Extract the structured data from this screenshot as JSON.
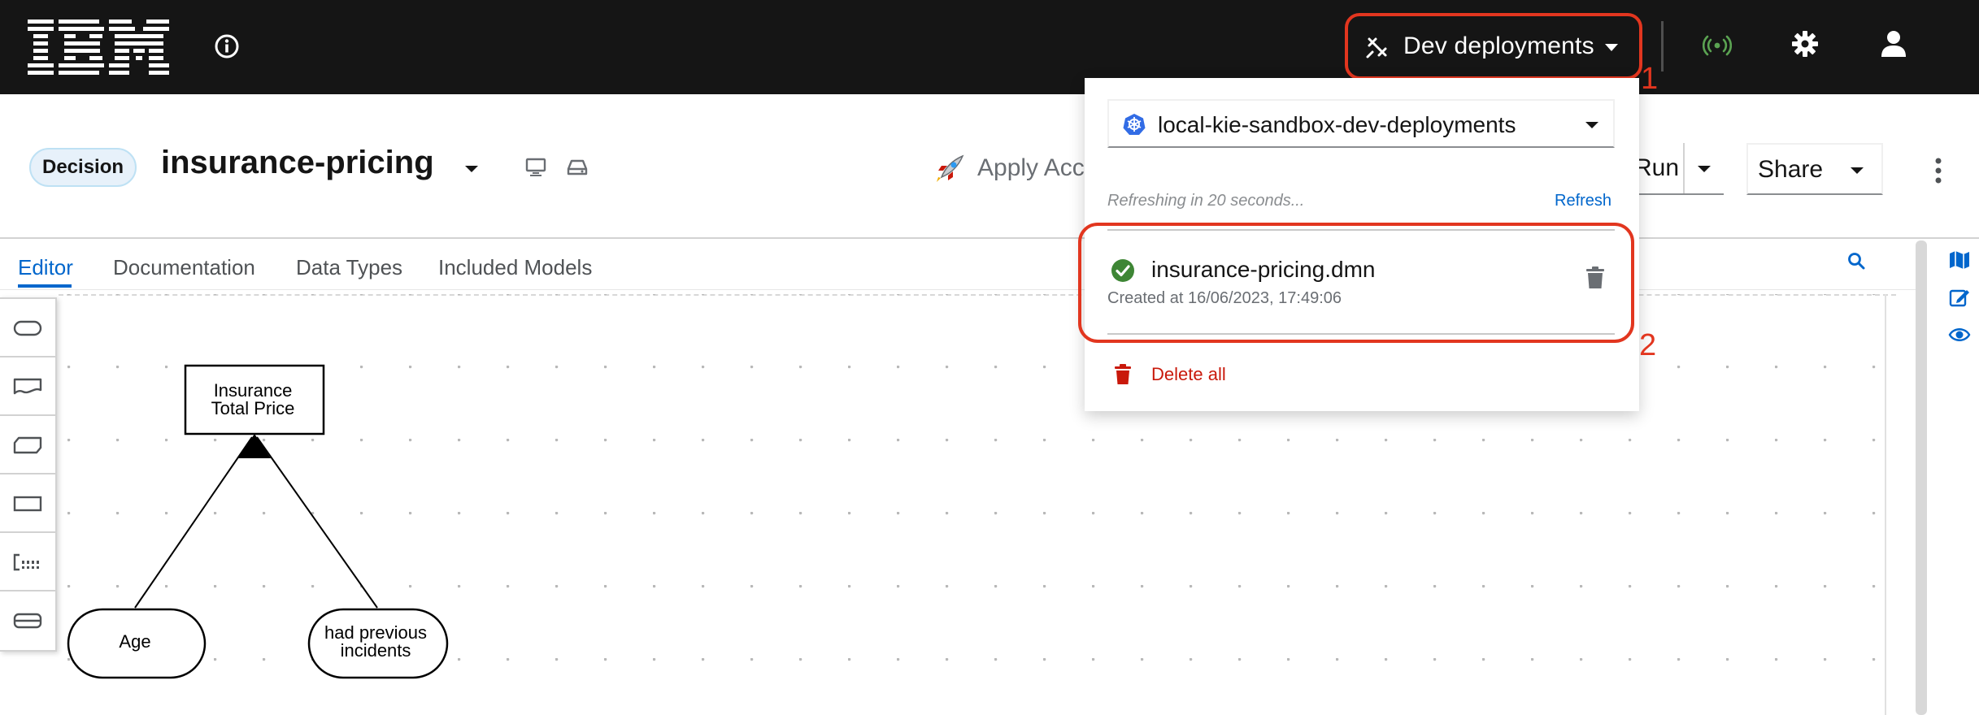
{
  "topbar": {
    "brand": "IBM",
    "dev_deployments_label": "Dev deployments",
    "callout_1": "1"
  },
  "header": {
    "badge": "Decision",
    "file_name": "insurance-pricing",
    "apply_label": "Apply Acce",
    "run_label": "Run",
    "share_label": "Share"
  },
  "tabs": [
    {
      "label": "Editor",
      "active": true
    },
    {
      "label": "Documentation",
      "active": false
    },
    {
      "label": "Data Types",
      "active": false
    },
    {
      "label": "Included Models",
      "active": false
    }
  ],
  "palette": {
    "items": [
      "input-data-tool",
      "knowledge-source-tool",
      "business-knowledge-tool",
      "decision-tool",
      "annotation-tool",
      "decision-service-tool"
    ]
  },
  "diagram": {
    "nodes": {
      "decision_line1": "Insurance",
      "decision_line2": "Total Price",
      "input_age": "Age",
      "input_incidents_line1": "had previous",
      "input_incidents_line2": "incidents"
    }
  },
  "popover": {
    "namespace": "local-kie-sandbox-dev-deployments",
    "refresh_note": "Refreshing in 20 seconds...",
    "refresh_link": "Refresh",
    "deployment": {
      "name": "insurance-pricing.dmn",
      "created": "Created at 16/06/2023, 17:49:06",
      "status": "success"
    },
    "delete_all": "Delete all",
    "callout_2": "2"
  },
  "colors": {
    "topbar_bg": "#151515",
    "accent_link": "#0066cc",
    "highlight_red": "#e2361f",
    "success_green": "#3e8635",
    "danger_red": "#c9190b"
  }
}
